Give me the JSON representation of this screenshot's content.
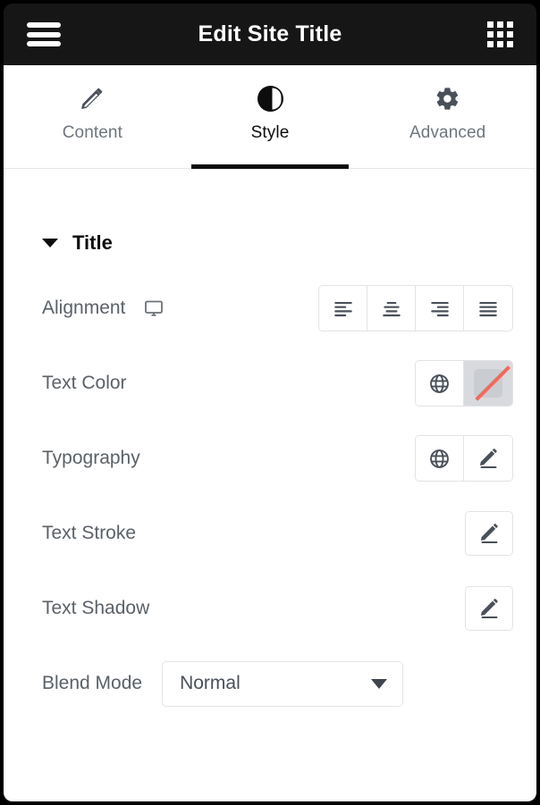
{
  "header": {
    "title": "Edit Site Title",
    "menu_icon": "hamburger-menu-icon",
    "apps_icon": "grid-apps-icon"
  },
  "tabs": [
    {
      "label": "Content",
      "icon": "pencil-icon",
      "active": false
    },
    {
      "label": "Style",
      "icon": "contrast-icon",
      "active": true
    },
    {
      "label": "Advanced",
      "icon": "gear-icon",
      "active": false
    }
  ],
  "section": {
    "title": "Title",
    "expanded": true,
    "caret_icon": "caret-down-icon"
  },
  "controls": {
    "alignment": {
      "label": "Alignment",
      "device_icon": "desktop-monitor-icon",
      "options": [
        {
          "name": "align-left",
          "icon": "align-left-icon",
          "selected": false
        },
        {
          "name": "align-center",
          "icon": "align-center-icon",
          "selected": false
        },
        {
          "name": "align-right",
          "icon": "align-right-icon",
          "selected": false
        },
        {
          "name": "align-justify",
          "icon": "align-justify-icon",
          "selected": false
        }
      ]
    },
    "text_color": {
      "label": "Text Color",
      "global_icon": "globe-icon",
      "swatch_icon": "no-color-swatch-icon"
    },
    "typography": {
      "label": "Typography",
      "global_icon": "globe-icon",
      "edit_icon": "pencil-edit-icon"
    },
    "text_stroke": {
      "label": "Text Stroke",
      "edit_icon": "pencil-edit-icon"
    },
    "text_shadow": {
      "label": "Text Shadow",
      "edit_icon": "pencil-edit-icon"
    },
    "blend_mode": {
      "label": "Blend Mode",
      "value": "Normal",
      "chevron_icon": "chevron-down-icon"
    }
  },
  "colors": {
    "header_bg": "#161616",
    "panel_bg": "#ffffff",
    "label": "#5b6168",
    "icon": "#4a5059",
    "border": "#e1e3e6",
    "accent_active": "#0d0d0d",
    "swatch_slash": "#f0695e"
  }
}
